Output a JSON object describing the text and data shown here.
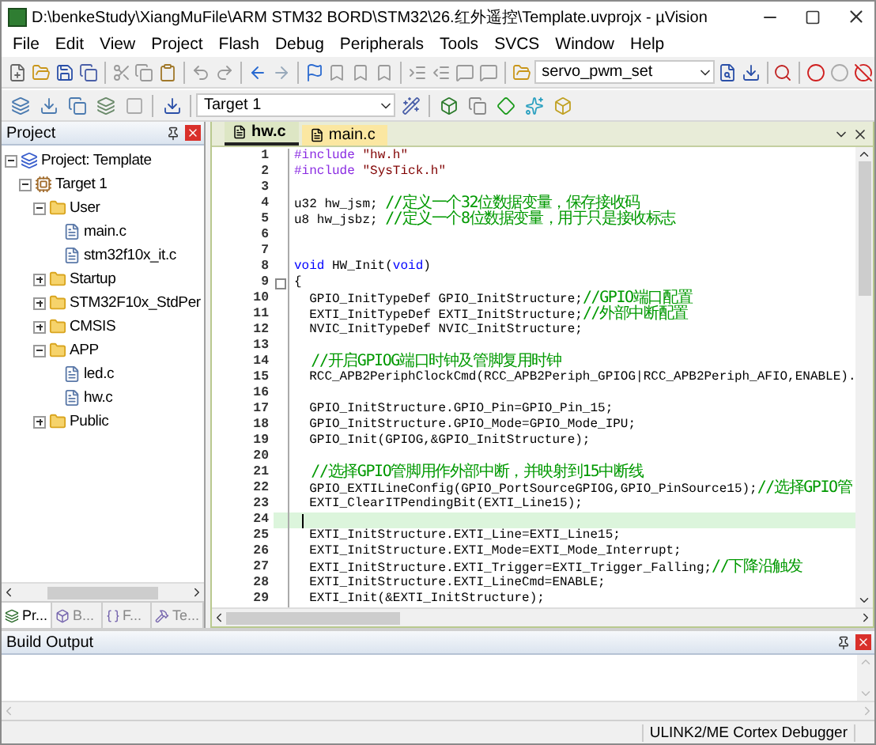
{
  "window": {
    "title": "D:\\benkeStudy\\XiangMuFile\\ARM STM32 BORD\\STM32\\26.红外遥控\\Template.uvprojx - µVision"
  },
  "menu": [
    "File",
    "Edit",
    "View",
    "Project",
    "Flash",
    "Debug",
    "Peripherals",
    "Tools",
    "SVCS",
    "Window",
    "Help"
  ],
  "toolbar": {
    "combo": "servo_pwm_set"
  },
  "build_toolbar": {
    "target": "Target 1"
  },
  "project_panel": {
    "title": "Project",
    "tree": [
      {
        "label": "Project: Template",
        "kind": "project",
        "expanded": true,
        "children": [
          {
            "label": "Target 1",
            "kind": "target",
            "expanded": true,
            "children": [
              {
                "label": "User",
                "kind": "folder",
                "expanded": true,
                "children": [
                  {
                    "label": "main.c",
                    "kind": "file"
                  },
                  {
                    "label": "stm32f10x_it.c",
                    "kind": "file"
                  }
                ]
              },
              {
                "label": "Startup",
                "kind": "folder",
                "expanded": false
              },
              {
                "label": "STM32F10x_StdPer",
                "kind": "folder",
                "expanded": false
              },
              {
                "label": "CMSIS",
                "kind": "folder",
                "expanded": false
              },
              {
                "label": "APP",
                "kind": "folder",
                "expanded": true,
                "children": [
                  {
                    "label": "led.c",
                    "kind": "file"
                  },
                  {
                    "label": "hw.c",
                    "kind": "file"
                  }
                ]
              },
              {
                "label": "Public",
                "kind": "folder",
                "expanded": false
              }
            ]
          }
        ]
      }
    ],
    "tabs": [
      {
        "label": "Pr...",
        "selected": true
      },
      {
        "label": "B...",
        "selected": false
      },
      {
        "label": "F...",
        "selected": false
      },
      {
        "label": "Te...",
        "selected": false
      }
    ]
  },
  "editor": {
    "tabs": [
      {
        "label": "hw.c",
        "selected": true
      },
      {
        "label": "main.c",
        "selected": false
      }
    ],
    "lines": [
      {
        "number": "1",
        "tokens": [
          {
            "kind": "directive",
            "text": "#include "
          },
          {
            "kind": "string",
            "text": "\"hw.h\""
          }
        ]
      },
      {
        "number": "2",
        "tokens": [
          {
            "kind": "directive",
            "text": "#include "
          },
          {
            "kind": "string",
            "text": "\"SysTick.h\""
          }
        ]
      },
      {
        "number": "3"
      },
      {
        "number": "4",
        "tokens": [
          {
            "kind": "code",
            "text": "u32 hw_jsm; "
          },
          {
            "kind": "comment",
            "text": "//定义一个32位数据变量，保存接收码"
          }
        ]
      },
      {
        "number": "5",
        "tokens": [
          {
            "kind": "code",
            "text": "u8 hw_jsbz; "
          },
          {
            "kind": "comment",
            "text": "//定义一个8位数据变量，用于只是接收标志"
          }
        ]
      },
      {
        "number": "6"
      },
      {
        "number": "7"
      },
      {
        "number": "8",
        "tokens": [
          {
            "kind": "keyword",
            "text": "void"
          },
          {
            "kind": "code",
            "text": " HW_Init("
          },
          {
            "kind": "keyword",
            "text": "void"
          },
          {
            "kind": "code",
            "text": ")"
          }
        ]
      },
      {
        "number": "9",
        "fold_marker": true,
        "tokens": [
          {
            "kind": "code",
            "text": "{"
          }
        ]
      },
      {
        "number": "10",
        "tokens": [
          {
            "kind": "code",
            "text": "  GPIO_InitTypeDef GPIO_InitStructure;"
          },
          {
            "kind": "comment",
            "text": "//GPIO端口配置"
          }
        ]
      },
      {
        "number": "11",
        "tokens": [
          {
            "kind": "code",
            "text": "  EXTI_InitTypeDef EXTI_InitStructure;"
          },
          {
            "kind": "comment",
            "text": "//外部中断配置"
          }
        ]
      },
      {
        "number": "12",
        "tokens": [
          {
            "kind": "code",
            "text": "  NVIC_InitTypeDef NVIC_InitStructure;"
          }
        ]
      },
      {
        "number": "13"
      },
      {
        "number": "14",
        "tokens": [
          {
            "kind": "comment",
            "text": "  //开启GPIOG端口时钟及管脚复用时钟"
          }
        ]
      },
      {
        "number": "15",
        "tokens": [
          {
            "kind": "code",
            "text": "  RCC_APB2PeriphClockCmd(RCC_APB2Periph_GPIOG|RCC_APB2Periph_AFIO,ENABLE)."
          }
        ]
      },
      {
        "number": "16"
      },
      {
        "number": "17",
        "tokens": [
          {
            "kind": "code",
            "text": "  GPIO_InitStructure.GPIO_Pin=GPIO_Pin_15;"
          }
        ]
      },
      {
        "number": "18",
        "tokens": [
          {
            "kind": "code",
            "text": "  GPIO_InitStructure.GPIO_Mode=GPIO_Mode_IPU;"
          }
        ]
      },
      {
        "number": "19",
        "tokens": [
          {
            "kind": "code",
            "text": "  GPIO_Init(GPIOG,&GPIO_InitStructure);"
          }
        ]
      },
      {
        "number": "20"
      },
      {
        "number": "21",
        "tokens": [
          {
            "kind": "comment",
            "text": "  //选择GPIO管脚用作外部中断，并映射到15中断线"
          }
        ]
      },
      {
        "number": "22",
        "tokens": [
          {
            "kind": "code",
            "text": "  GPIO_EXTILineConfig(GPIO_PortSourceGPIOG,GPIO_PinSource15);"
          },
          {
            "kind": "comment",
            "text": "//选择GPIO管"
          }
        ]
      },
      {
        "number": "23",
        "tokens": [
          {
            "kind": "code",
            "text": "  EXTI_ClearITPendingBit(EXTI_Line15);"
          }
        ]
      },
      {
        "number": "24",
        "current": true
      },
      {
        "number": "25",
        "tokens": [
          {
            "kind": "code",
            "text": "  EXTI_InitStructure.EXTI_Line=EXTI_Line15;"
          }
        ]
      },
      {
        "number": "26",
        "tokens": [
          {
            "kind": "code",
            "text": "  EXTI_InitStructure.EXTI_Mode=EXTI_Mode_Interrupt;"
          }
        ]
      },
      {
        "number": "27",
        "tokens": [
          {
            "kind": "code",
            "text": "  EXTI_InitStructure.EXTI_Trigger=EXTI_Trigger_Falling;"
          },
          {
            "kind": "comment",
            "text": "//下降沿触发"
          }
        ]
      },
      {
        "number": "28",
        "tokens": [
          {
            "kind": "code",
            "text": "  EXTI_InitStructure.EXTI_LineCmd=ENABLE;"
          }
        ]
      },
      {
        "number": "29",
        "tokens": [
          {
            "kind": "code",
            "text": "  EXTI_Init(&EXTI_InitStructure);"
          }
        ]
      }
    ]
  },
  "build_output": {
    "title": "Build Output"
  },
  "status_bar": {
    "debugger": "ULINK2/ME Cortex Debugger"
  }
}
